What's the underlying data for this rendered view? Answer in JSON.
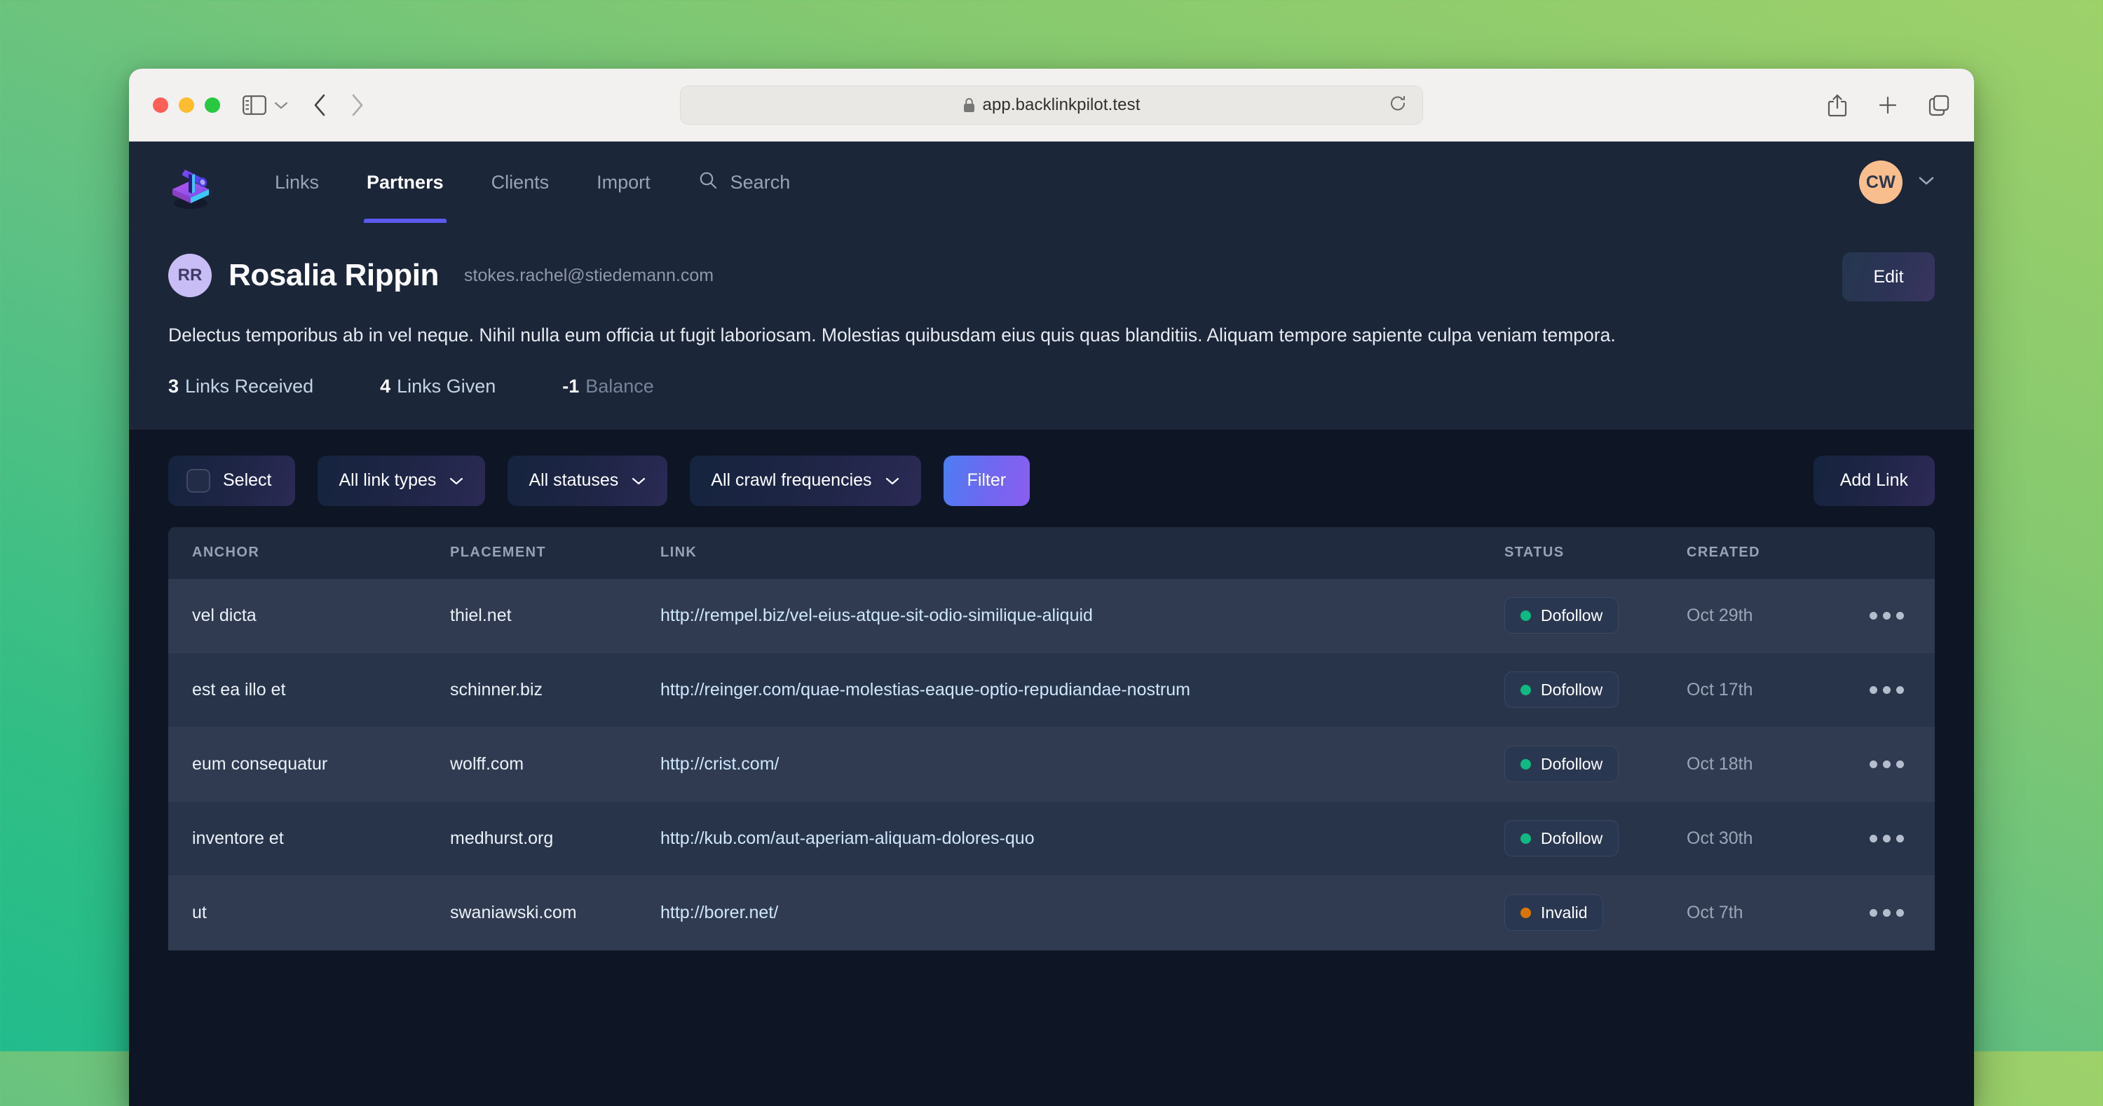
{
  "browser": {
    "url": "app.backlinkpilot.test",
    "lock_icon": "lock-icon",
    "reload_icon": "reload-icon",
    "sidebar_icon": "sidebar-toggle-icon",
    "back_icon": "back-arrow-icon",
    "forward_icon": "forward-arrow-icon",
    "share_icon": "share-icon",
    "newtab_icon": "plus-icon",
    "tabs_icon": "tab-overview-icon"
  },
  "nav": {
    "logo": "telescope-logo",
    "items": [
      {
        "label": "Links",
        "active": false
      },
      {
        "label": "Partners",
        "active": true
      },
      {
        "label": "Clients",
        "active": false
      },
      {
        "label": "Import",
        "active": false
      },
      {
        "label": "Search",
        "active": false,
        "icon": "search-icon"
      }
    ],
    "user": {
      "initials": "CW",
      "avatar_color": "#F9BE8E",
      "chevron": "chevron-down-icon"
    }
  },
  "profile": {
    "initials": "RR",
    "avatar_color": "#C9BDF6",
    "name": "Rosalia Rippin",
    "email": "stokes.rachel@stiedemann.com",
    "edit_label": "Edit",
    "description": "Delectus temporibus ab in vel neque. Nihil nulla eum officia ut fugit laboriosam. Molestias quibusdam eius quis quas blanditiis. Aliquam tempore sapiente culpa veniam tempora.",
    "stats": [
      {
        "value": "3",
        "label": "Links Received"
      },
      {
        "value": "4",
        "label": "Links Given"
      },
      {
        "value": "-1",
        "label": "Balance"
      }
    ]
  },
  "toolbar": {
    "select_label": "Select",
    "link_types_label": "All link types",
    "statuses_label": "All statuses",
    "crawl_label": "All crawl frequencies",
    "filter_label": "Filter",
    "add_link_label": "Add Link"
  },
  "table": {
    "headers": [
      "ANCHOR",
      "PLACEMENT",
      "LINK",
      "STATUS",
      "CREATED"
    ],
    "rows": [
      {
        "anchor": "vel dicta",
        "placement": "thiel.net",
        "link": "http://rempel.biz/vel-eius-atque-sit-odio-similique-aliquid",
        "status": "Dofollow",
        "status_color": "#10B981",
        "created": "Oct 29th"
      },
      {
        "anchor": "est ea illo et",
        "placement": "schinner.biz",
        "link": "http://reinger.com/quae-molestias-eaque-optio-repudiandae-nostrum",
        "status": "Dofollow",
        "status_color": "#10B981",
        "created": "Oct 17th"
      },
      {
        "anchor": "eum consequatur",
        "placement": "wolff.com",
        "link": "http://crist.com/",
        "status": "Dofollow",
        "status_color": "#10B981",
        "created": "Oct 18th"
      },
      {
        "anchor": "inventore et",
        "placement": "medhurst.org",
        "link": "http://kub.com/aut-aperiam-aliquam-dolores-quo",
        "status": "Dofollow",
        "status_color": "#10B981",
        "created": "Oct 30th"
      },
      {
        "anchor": "ut",
        "placement": "swaniawski.com",
        "link": "http://borer.net/",
        "status": "Invalid",
        "status_color": "#D97706",
        "created": "Oct 7th"
      }
    ]
  }
}
